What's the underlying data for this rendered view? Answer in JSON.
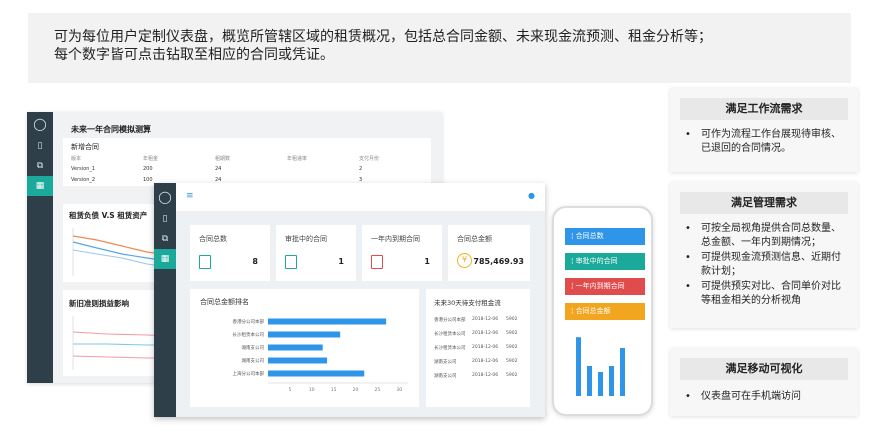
{
  "banner": {
    "line1": "可为每位用户定制仪表盘，概览所管辖区域的租赁概况，包括总合同金额、未来现金流预测、租金分析等；",
    "line2": "每个数字皆可点击钻取至相应的合同或凭证。"
  },
  "back_dashboard": {
    "section_title": "未来一年合同模拟测算",
    "new_contract_title": "新增合同",
    "columns": [
      "版本",
      "年租金",
      "租期数",
      "年租递率",
      "支付月份"
    ],
    "rows": [
      [
        "Version_1",
        "200",
        "24",
        "",
        "2"
      ],
      [
        "Version_2",
        "100",
        "24",
        "",
        "3"
      ]
    ],
    "chart1_title": "租赁负债 V.S 租赁资产",
    "chart2_title": "新旧准则损益影响"
  },
  "front_dashboard": {
    "kpis": [
      {
        "label": "合同总数",
        "value": "8",
        "icon": "contract-doc-icon",
        "color": "#1aa99a"
      },
      {
        "label": "审批中的合同",
        "value": "1",
        "icon": "contract-doc-icon",
        "color": "#1aa99a"
      },
      {
        "label": "一年内到期合同",
        "value": "1",
        "icon": "contract-doc-icon",
        "color": "#e04c4c"
      },
      {
        "label": "合同总金额",
        "value": "785,469.93",
        "icon": "yen-coin-icon",
        "color": "#f2b01e"
      }
    ],
    "bar_chart": {
      "title": "合同总金额排名",
      "categories": [
        "香港分公司本部",
        "长沙租赁本公司",
        "湖南支公司",
        "湖南支公司",
        "上海分公司本部"
      ],
      "values": [
        27,
        16.5,
        12.5,
        13.5,
        22
      ],
      "ticks": [
        "5",
        "10",
        "15",
        "20",
        "25",
        "30"
      ],
      "color": "#2f95e8"
    },
    "cashflow": {
      "title": "未来30天待支付租金流",
      "rows": [
        [
          "香港分公司本部",
          "2018-12-06",
          "5902"
        ],
        [
          "长沙租赁本公司",
          "2018-12-06",
          "5902"
        ],
        [
          "长沙租赁本公司",
          "2018-12-06",
          "5902"
        ],
        [
          "湖南支公司",
          "2018-12-06",
          "5902"
        ],
        [
          "湖南支公司",
          "2018-12-06",
          "5902"
        ]
      ]
    }
  },
  "phone": {
    "buttons": [
      {
        "label": "合同总数",
        "color": "#2f95e8"
      },
      {
        "label": "审批中的合同",
        "color": "#1aa99a"
      },
      {
        "label": "一年内到期合同",
        "color": "#e04c4c"
      },
      {
        "label": "合同总金额",
        "color": "#f2a51e"
      }
    ],
    "bars": [
      0.98,
      0.5,
      0.4,
      0.5,
      0.8
    ]
  },
  "panels": [
    {
      "title": "满足工作流需求",
      "items": [
        "可作为流程工作台展现待审核、已退回的合同情况。"
      ]
    },
    {
      "title": "满足管理需求",
      "items": [
        "可按全局视角提供合同总数量、总金额、一年内到期情况；",
        "可提供现金流预测信息、近期付款计划；",
        "可提供预实对比、合同单价对比等租金相关的分析视角"
      ]
    },
    {
      "title": "满足移动可视化",
      "items": [
        "仪表盘可在手机端访问"
      ]
    }
  ]
}
